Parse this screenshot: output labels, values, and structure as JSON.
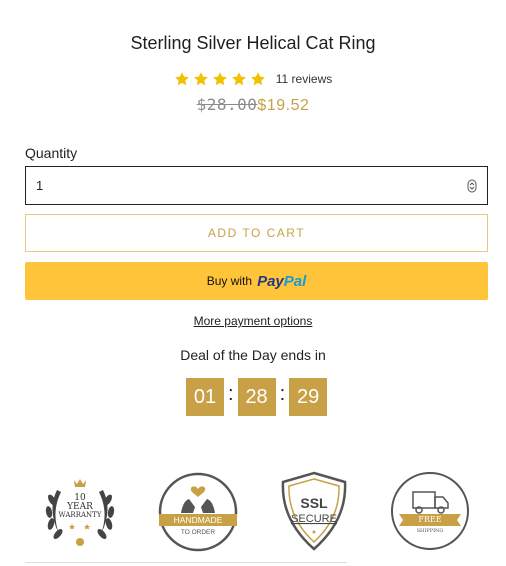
{
  "product": {
    "title": "Sterling Silver Helical Cat Ring",
    "rating": 5,
    "reviews_text": "11 reviews",
    "price_old": "$28.00",
    "price_new": "$19.52"
  },
  "quantity": {
    "label": "Quantity",
    "value": "1"
  },
  "buttons": {
    "add_to_cart": "ADD TO CART",
    "paypal_prefix": "Buy with",
    "paypal_pay": "Pay",
    "paypal_pal": "Pal",
    "more_options": "More payment options"
  },
  "deal": {
    "label": "Deal of the Day ends in",
    "hours": "01",
    "minutes": "28",
    "seconds": "29",
    "separator": ":"
  },
  "badges": {
    "warranty": {
      "num": "10",
      "line1": "YEAR",
      "line2": "WARRANTY"
    },
    "handmade": {
      "line1": "HANDMADE",
      "line2": "TO ORDER"
    },
    "ssl": {
      "line1": "SSL",
      "line2": "SECURE"
    },
    "shipping": {
      "line1": "FREE",
      "line2": "SHIPPING"
    }
  },
  "colors": {
    "accent": "#c8a046",
    "paypal": "#ffc439",
    "star": "#f2c200"
  },
  "icons": [
    "star-icon",
    "spinner-icon",
    "laurel-icon",
    "hands-icon",
    "shield-icon",
    "truck-icon"
  ]
}
